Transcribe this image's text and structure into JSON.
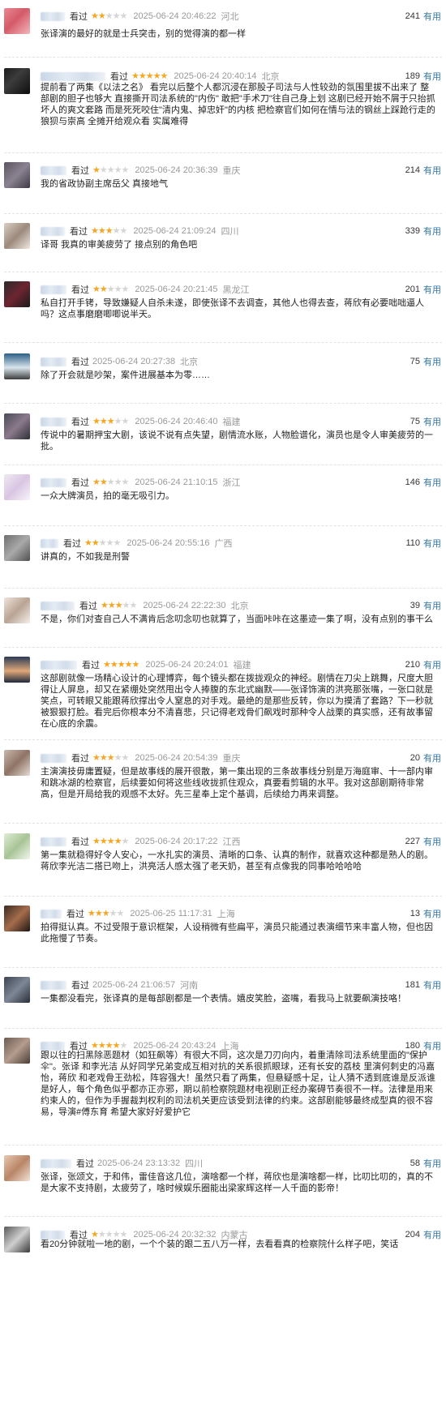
{
  "labels": {
    "watched": "看过",
    "useful": "有用"
  },
  "colors": {
    "star_on": "#f5a623",
    "star_off": "#d5d5d5",
    "link": "#3377aa",
    "meta_gray": "#999999"
  },
  "reviews": [
    {
      "avatar": "avatar-image-pink",
      "rating": 2,
      "time": "2025-06-24 20:46:22",
      "location": "河北",
      "useful_count": "241",
      "content": "张译演的最好的就是士兵突击，别的觉得演的都一样"
    },
    {
      "avatar": "avatar-image-dark",
      "rating": 5,
      "time": "2025-06-24 20:40:14",
      "location": "北京",
      "useful_count": "189",
      "content": "提前看了两集《以法之名》 看完以后整个人都沉浸在那股子司法与人性较劲的氛围里拔不出来了 整部剧的胆子也够大 直接撕开司法系统的\"内伤\" 敢把\"手术刀\"往自己身上划 这剧已经开始不屑于只抬抓坏人的爽文套路 而是死死咬住\"清内鬼、掉忠奸\"的内核 把检察官们如何在情与法的钢丝上踩跄行走的狼狈与崇高 全摊开给观众看 实属难得"
    },
    {
      "avatar": "avatar-image-gray",
      "rating": 1,
      "time": "2025-06-24 20:36:39",
      "location": "重庆",
      "useful_count": "214",
      "content": "我的省政协副主席岳父 真接地气"
    },
    {
      "avatar": "avatar-image-beige",
      "rating": 3,
      "time": "2025-06-24 21:09:24",
      "location": "四川",
      "useful_count": "339",
      "content": "译哥 我真的审美疲劳了 接点别的角色吧"
    },
    {
      "avatar": "avatar-image-dark-red",
      "rating": 2,
      "time": "2025-06-24 20:21:45",
      "location": "黑龙江",
      "useful_count": "201",
      "content": "私自打开手铐，导致嫌疑人自杀未遂，即使张译不去调查，其他人也得去查，蒋欣有必要咄咄逼人吗？这点事磨磨唧唧说半天。"
    },
    {
      "avatar": "avatar-image-landscape",
      "rating": 0,
      "time": "2025-06-24 20:27:38",
      "location": "北京",
      "useful_count": "75",
      "content": "除了开会就是吵架，案件进展基本为零……"
    },
    {
      "avatar": "avatar-image-purple-gray",
      "rating": 3,
      "time": "2025-06-24 20:46:40",
      "location": "福建",
      "useful_count": "75",
      "content": "传说中的暑期押宝大剧，该说不说有点失望，剧情流水账，人物脸谱化，演员也是令人审美疲劳的一批。"
    },
    {
      "avatar": "avatar-image-lavender",
      "rating": 2,
      "time": "2025-06-24 21:10:15",
      "location": "浙江",
      "useful_count": "146",
      "content": "一众大牌演员，拍的毫无吸引力。"
    },
    {
      "avatar": "avatar-image-mid-gray",
      "rating": 2,
      "time": "2025-06-24 20:55:16",
      "location": "广西",
      "useful_count": "110",
      "content": "讲真的，不如我是刑警"
    },
    {
      "avatar": "avatar-image-light",
      "rating": 3,
      "time": "2025-06-24 22:22:30",
      "location": "北京",
      "useful_count": "39",
      "content": "不是，你们对查自己人不满肯后念叨念叨也就算了，当面咔咔在这墨迹一集了啊，没有点别的事干么"
    },
    {
      "avatar": "avatar-image-sunset",
      "rating": 5,
      "time": "2025-06-24 20:24:01",
      "location": "福建",
      "useful_count": "210",
      "content": "这部剧就像一场精心设计的心理博弈，每个镜头都在拨拢观众的神经。剧情在刀尖上跳舞，尺度大胆得让人屏息，却又在紧绷处突然甩出令人捧腹的东北式幽默——张译饰演的洪亮那张嘴，一张口就是笑点，可转眼又能跟蒋欣撑出令人窒息的对手戏。最绝的是那些反转，你以为摸清了套路？下一秒就被狠狠打脸。看完后你根本分不清喜悲，只记得老戏骨们飙戏时那种令人战栗的真实感，还有故事留在心底的余震。"
    },
    {
      "avatar": "avatar-image-warm-gray",
      "rating": 3,
      "time": "2025-06-24 20:54:39",
      "location": "重庆",
      "useful_count": "20",
      "content": "主演演技毋庸置疑，但是故事线的展开很散，第一集出现的三条故事线分别是万海庭审、十一部内审和跳冰湖的检察官，后续要如何将这些线收拢抓住观众，真要看剪辑的水平。我对这部剧期待非常高，但是开局给我的观感不太好。先三星奉上定个基调，后续给力再来调整。"
    },
    {
      "avatar": "avatar-image-green",
      "rating": 4,
      "time": "2025-06-24 20:17:22",
      "location": "江西",
      "useful_count": "227",
      "content": "第一集就稳得好令人安心，一水扎实的演员、清晰的口条、认真的制作，就喜欢这种都是熟人的剧。蒋欣李光洁二搭已吻上，洪亮活人感太强了老天奶，甚至有点像我的同事哈哈哈哈"
    },
    {
      "avatar": "avatar-image-brown",
      "rating": 3,
      "time": "2025-06-25 11:17:31",
      "location": "上海",
      "useful_count": "13",
      "content": "拍得挺认真。不过受限于意识框架，人设稍微有些扁平，演员只能通过表演细节来丰富人物，但也因此拖慢了节奏。"
    },
    {
      "avatar": "avatar-image-slate",
      "rating": 0,
      "time": "2025-06-24 21:06:57",
      "location": "河南",
      "useful_count": "181",
      "content": "一集都没看完，张译真的是每部剧都是一个表情。嬉皮笑脸，盗嘴，看我马上就要飙演技咯！"
    },
    {
      "avatar": "avatar-image-taupe",
      "rating": 4,
      "time": "2025-06-24 20:43:24",
      "location": "上海",
      "useful_count": "180",
      "content": "跟以往的扫黑除恶题材（如狂飙等）有很大不同，这次是刀刃向内，着重清除司法系统里面的\"保护伞\"。张译 和李光洁 从好同学兄弟变成互相对抗的关系很抓眼球，还有长安的荔枝 里演何刺史的冯嘉怡，蒋欣 和老戏骨王劲松，阵容强大！虽然只看了两集，但悬疑感十足，让人猜不透到底谁是反派谁是好人，每个角色似乎都亦正亦邪，期以前检察院题材电视剧正经办案碍节奏很不一样。法律是用来约束人的，但作为手握裁判权利的司法机关更应该受到法律的约束。这部剧能够最终成型真的很不容易，导演#傅东育 希望大家好好爱护它"
    },
    {
      "avatar": "avatar-image-peach",
      "rating": 0,
      "time": "2025-06-24 23:13:32",
      "location": "四川",
      "useful_count": "58",
      "content": "张译，张颂文，于和伟，雷佳音这几位，演啥都一个样，蒋欣也是演啥都一样，比叨比叨的，真的不是大家不支持剧，太疲劳了，啥时候娱乐圈能出梁家辉这样一人千面的影帝！"
    },
    {
      "avatar": "avatar-image-mono",
      "rating": 1,
      "time": "2025-06-24 20:32:32",
      "location": "内蒙古",
      "useful_count": "204",
      "content": "看20分钟就啦一地的剧，一个个装的跟二五八万一样，去看看真的检察院什么样子吧，笑话"
    }
  ]
}
